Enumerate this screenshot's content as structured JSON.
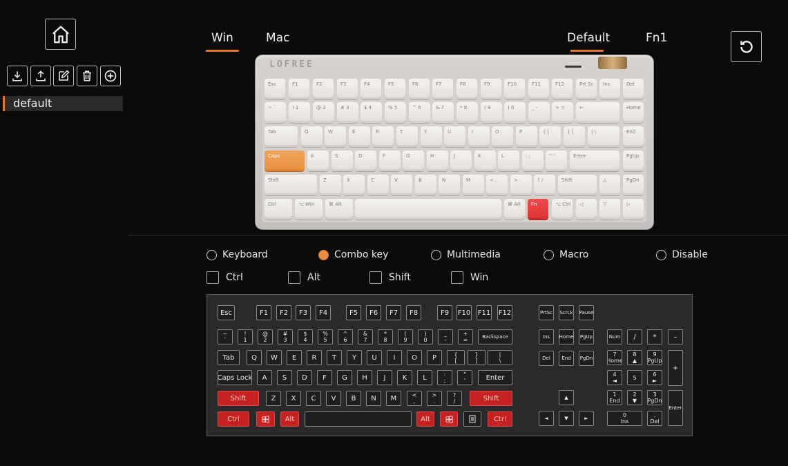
{
  "sidebar": {
    "profiles": [
      "default"
    ],
    "toolbar": [
      "download-icon",
      "upload-icon",
      "edit-icon",
      "trash-icon",
      "plus-icon"
    ]
  },
  "os_tabs": [
    {
      "label": "Win",
      "active": true
    },
    {
      "label": "Mac",
      "active": false
    }
  ],
  "layer_tabs": [
    {
      "label": "Default",
      "active": true
    },
    {
      "label": "Fn1",
      "active": false
    }
  ],
  "keyboard_photo": {
    "brand": "LOFREE",
    "rows": [
      [
        "Esc",
        "F1",
        "F2",
        "F3",
        "F4",
        "F5",
        "F6",
        "F7",
        "F8",
        "F9",
        "F10",
        "F11",
        "F12",
        "Prt Sc",
        "Ins",
        "Del"
      ],
      [
        "~ `",
        "! 1",
        "@ 2",
        "# 3",
        "$ 4",
        "% 5",
        "^ 6",
        "& 7",
        "* 8",
        "( 9",
        ") 0",
        "_ -",
        "+ =",
        "←",
        "Home"
      ],
      [
        "Tab",
        "Q",
        "W",
        "E",
        "R",
        "T",
        "Y",
        "U",
        "I",
        "O",
        "P",
        "{ [",
        "} ]",
        "| \\",
        "End"
      ],
      [
        "Caps",
        "A",
        "S",
        "D",
        "F",
        "G",
        "H",
        "J",
        "K",
        "L",
        ": ;",
        "\" '",
        "Enter",
        "PgUp"
      ],
      [
        "Shift",
        "Z",
        "X",
        "C",
        "V",
        "B",
        "N",
        "M",
        "< ,",
        "> .",
        "? /",
        "Shift",
        "△",
        "PgDn"
      ],
      [
        "Ctrl",
        "⌥ Win",
        "⌘ Alt",
        "",
        "⌘ Alt",
        "Fn",
        "⌥ Ctrl",
        "◁",
        "▽",
        "▷"
      ]
    ]
  },
  "modes": [
    {
      "label": "Keyboard",
      "selected": false
    },
    {
      "label": "Combo key",
      "selected": true
    },
    {
      "label": "Multimedia",
      "selected": false
    },
    {
      "label": "Macro",
      "selected": false
    },
    {
      "label": "Disable",
      "selected": false
    }
  ],
  "modifiers": [
    {
      "label": "Ctrl",
      "checked": false
    },
    {
      "label": "Alt",
      "checked": false
    },
    {
      "label": "Shift",
      "checked": false
    },
    {
      "label": "Win",
      "checked": false
    }
  ],
  "virtual_keyboard": {
    "fn_row": [
      "Esc",
      "F1",
      "F2",
      "F3",
      "F4",
      "F5",
      "F6",
      "F7",
      "F8",
      "F9",
      "F10",
      "F11",
      "F12"
    ],
    "num_row": [
      "~\n`",
      "!\n1",
      "@\n2",
      "#\n3",
      "$\n4",
      "%\n5",
      "^\n6",
      "&\n7",
      "*\n8",
      "(\n9",
      ")\n0",
      "_\n-",
      "+\n=",
      "Backspace"
    ],
    "tab_row": [
      "Tab",
      "Q",
      "W",
      "E",
      "R",
      "T",
      "Y",
      "U",
      "I",
      "O",
      "P",
      "{\n[",
      "}\n]",
      "|\n\\"
    ],
    "caps_row": [
      "Caps Lock",
      "A",
      "S",
      "D",
      "F",
      "G",
      "H",
      "J",
      "K",
      "L",
      ":\n;",
      "\"\n'",
      "Enter"
    ],
    "shift_row": [
      "Shift",
      "Z",
      "X",
      "C",
      "V",
      "B",
      "N",
      "M",
      "<\n,",
      ">\n.",
      "?\n/",
      "Shift"
    ],
    "bottom_row": [
      "Ctrl",
      "win-icon",
      "Alt",
      "",
      "Alt",
      "win-icon",
      "menu-icon",
      "Ctrl"
    ],
    "nav_top": [
      "PrtSc",
      "ScrLk",
      "Pause"
    ],
    "nav_mid1": [
      "Ins",
      "Home",
      "PgUp"
    ],
    "nav_mid2": [
      "Del",
      "End",
      "PgDn"
    ],
    "arrows": [
      "▲",
      "◄",
      "▼",
      "►"
    ],
    "numpad": {
      "row1": [
        "Num",
        "/",
        "*",
        "–"
      ],
      "row2": [
        "7\nHome",
        "8\n▲",
        "9\nPgUp"
      ],
      "row3": [
        "4\n◄",
        "5",
        "6\n►"
      ],
      "row4": [
        "1\nEnd",
        "2\n▼",
        "3\nPgDn"
      ],
      "zero": "0\nIns",
      "dot": ".\nDel",
      "plus": "+",
      "enter": "Enter"
    },
    "selected_keys": [
      "Shift",
      "Ctrl",
      "Alt",
      "win-icon"
    ]
  },
  "colors": {
    "accent": "#e7772a",
    "selected_key": "#c62222"
  }
}
